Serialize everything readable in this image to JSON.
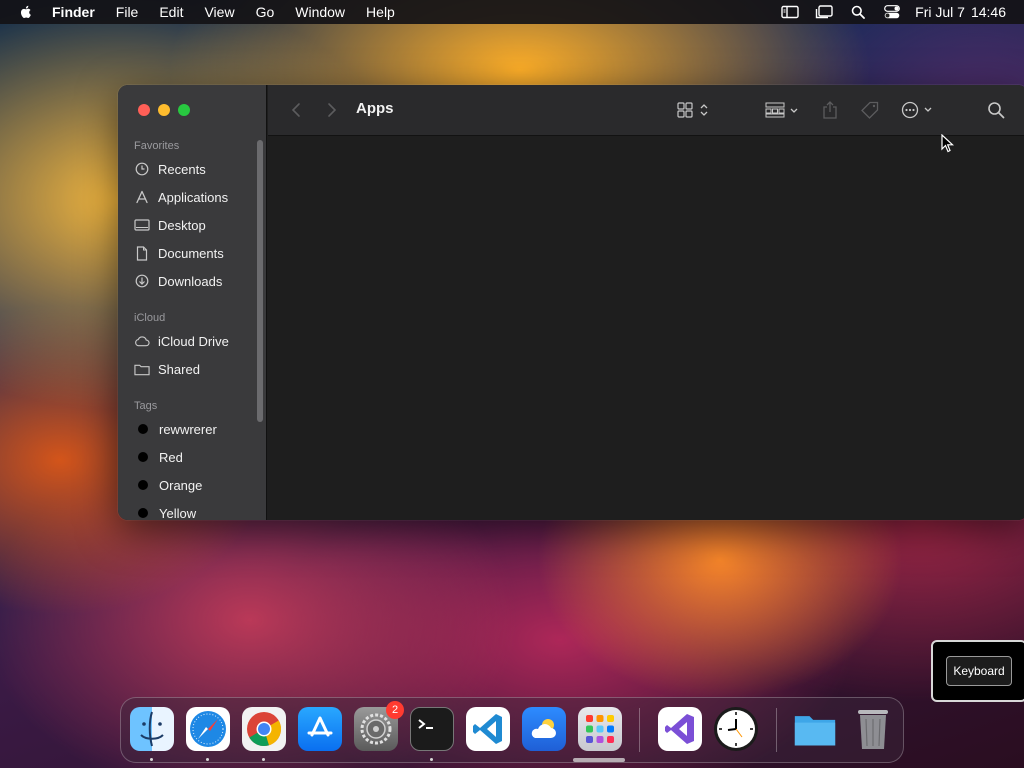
{
  "menubar": {
    "app_name": "Finder",
    "items": [
      "File",
      "Edit",
      "View",
      "Go",
      "Window",
      "Help"
    ],
    "clock_date": "Fri Jul 7",
    "clock_time": "14:46",
    "status_icons": [
      "screen-mirror-icon",
      "stage-manager-icon",
      "spotlight-search-icon",
      "control-center-icon"
    ]
  },
  "finder": {
    "title": "Apps",
    "sidebar": {
      "favorites_title": "Favorites",
      "favorites": [
        {
          "label": "Recents",
          "icon": "clock-icon"
        },
        {
          "label": "Applications",
          "icon": "applications-icon"
        },
        {
          "label": "Desktop",
          "icon": "desktop-icon"
        },
        {
          "label": "Documents",
          "icon": "document-icon"
        },
        {
          "label": "Downloads",
          "icon": "download-icon"
        }
      ],
      "icloud_title": "iCloud",
      "icloud": [
        {
          "label": "iCloud Drive",
          "icon": "cloud-icon"
        },
        {
          "label": "Shared",
          "icon": "shared-folder-icon"
        }
      ],
      "tags_title": "Tags",
      "tags": [
        {
          "label": "rewwrerer",
          "color": "#000000"
        },
        {
          "label": "Red",
          "color": "#000000"
        },
        {
          "label": "Orange",
          "color": "#000000"
        },
        {
          "label": "Yellow",
          "color": "#000000"
        }
      ]
    },
    "toolbar_icons": [
      "back-icon",
      "forward-icon",
      "icon-view-icon",
      "group-icon",
      "share-icon",
      "tag-icon",
      "more-actions-icon",
      "search-icon"
    ]
  },
  "tooltip": {
    "label": "Keyboard"
  },
  "dock": {
    "apps": [
      "Finder",
      "Safari",
      "Google Chrome",
      "App Store",
      "System Settings",
      "Terminal",
      "Visual Studio Code",
      "Weather",
      "Launchpad",
      "Visual Studio",
      "Clock",
      "Downloads Folder",
      "Trash"
    ],
    "settings_badge": "2"
  },
  "colors": {
    "close": "#ff5f57",
    "minimize": "#febc2e",
    "maximize": "#28c840",
    "badge": "#ff3b30"
  }
}
